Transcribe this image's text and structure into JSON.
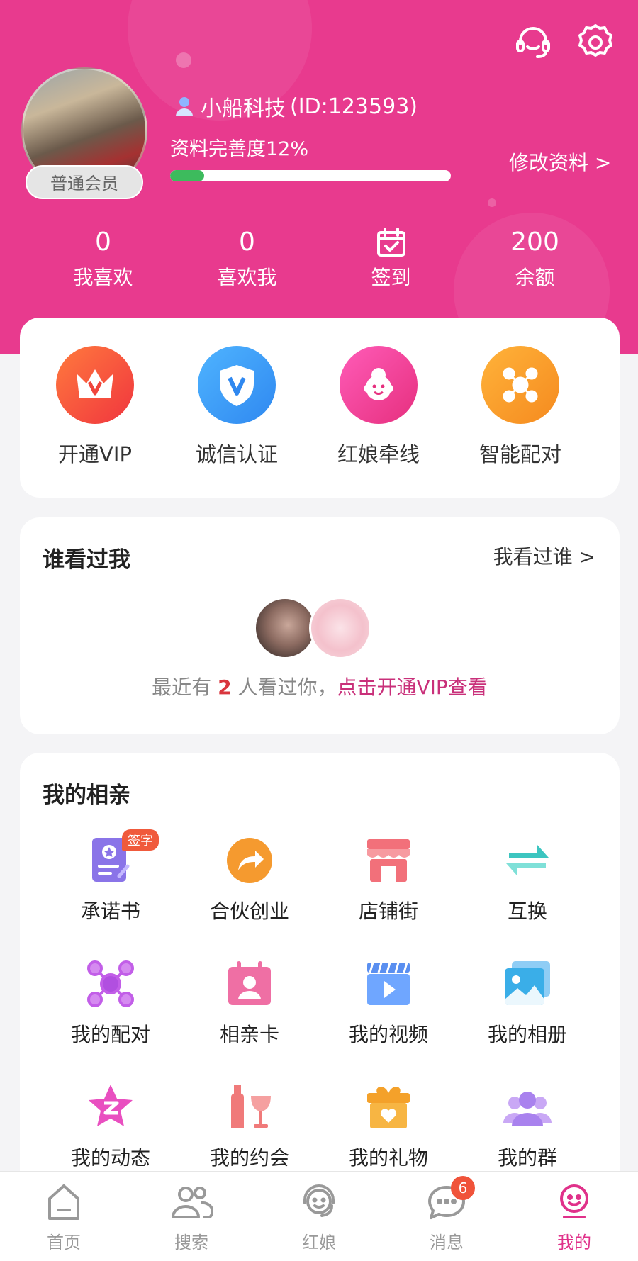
{
  "colors": {
    "brand": "#e83a8e",
    "accent_text": "#c9307a",
    "progress": "#3dbb5d",
    "badge": "#f0533a"
  },
  "header": {
    "icons": [
      "headset-icon",
      "gear-icon"
    ],
    "member_badge": "普通会员",
    "username": "小船科技",
    "user_id": "(ID:123593)",
    "completeness_label": "资料完善度12%",
    "completeness_fraction": 0.12,
    "edit_link": "修改资料 >"
  },
  "stats": [
    {
      "value": "0",
      "label": "我喜欢"
    },
    {
      "value": "0",
      "label": "喜欢我"
    },
    {
      "label": "签到",
      "icon": "calendar-check-icon"
    },
    {
      "value": "200",
      "label": "余额"
    }
  ],
  "quick_actions": [
    {
      "label": "开通VIP",
      "icon": "crown-icon"
    },
    {
      "label": "诚信认证",
      "icon": "shield-v-icon"
    },
    {
      "label": "红娘牵线",
      "icon": "matchmaker-icon"
    },
    {
      "label": "智能配对",
      "icon": "network-icon"
    }
  ],
  "visitors": {
    "title": "谁看过我",
    "link": "我看过谁 >",
    "text_prefix": "最近有",
    "count": "2",
    "text_suffix": "人看过你，",
    "cta": "点击开通VIP查看"
  },
  "dating": {
    "title": "我的相亲",
    "sign_badge": "签字",
    "items": [
      {
        "label": "承诺书",
        "icon": "pledge-icon"
      },
      {
        "label": "合伙创业",
        "icon": "share-arrow-icon"
      },
      {
        "label": "店铺街",
        "icon": "shop-icon"
      },
      {
        "label": "互换",
        "icon": "swap-icon"
      },
      {
        "label": "我的配对",
        "icon": "pairing-icon"
      },
      {
        "label": "相亲卡",
        "icon": "profile-card-icon"
      },
      {
        "label": "我的视频",
        "icon": "video-icon"
      },
      {
        "label": "我的相册",
        "icon": "album-icon"
      },
      {
        "label": "我的动态",
        "icon": "star-z-icon"
      },
      {
        "label": "我的约会",
        "icon": "wine-icon"
      },
      {
        "label": "我的礼物",
        "icon": "gift-icon"
      },
      {
        "label": "我的群",
        "icon": "group-icon"
      }
    ]
  },
  "tabbar": {
    "items": [
      {
        "label": "首页",
        "icon": "home-icon"
      },
      {
        "label": "搜索",
        "icon": "users-search-icon"
      },
      {
        "label": "红娘",
        "icon": "headset-person-icon"
      },
      {
        "label": "消息",
        "icon": "chat-icon",
        "badge": "6"
      },
      {
        "label": "我的",
        "icon": "me-icon",
        "active": true
      }
    ]
  }
}
